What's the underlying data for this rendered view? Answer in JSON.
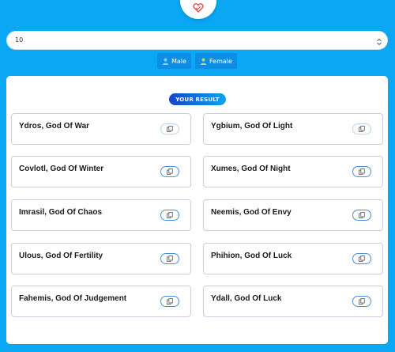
{
  "header": {
    "logo_icon": "heart-logo-icon"
  },
  "count_select": {
    "value": "10"
  },
  "gender": {
    "male_label": "Male",
    "female_label": "Female",
    "icon": "person-icon"
  },
  "result": {
    "badge": "YOUR RESULT",
    "names": [
      "Ydros, God Of War",
      "Ygbium, God Of Light",
      "Covlotl, God Of Winter",
      "Xumes, God Of Night",
      "Imrasil, God Of Chaos",
      "Neemis, God Of Envy",
      "Ulous, God Of Fertility",
      "Phihion, God Of Luck",
      "Fahemis, God Of Judgement",
      "Ydall, God Of Luck"
    ]
  },
  "colors": {
    "background": "#0aa8f4",
    "button": "#0d8ee6",
    "badge_start": "#1346c9",
    "badge_end": "#0ba3f2",
    "copy_border": "#4a8fd8"
  }
}
